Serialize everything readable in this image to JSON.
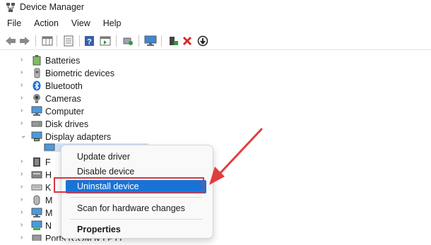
{
  "window": {
    "title": "Device Manager"
  },
  "menubar": {
    "items": [
      "File",
      "Action",
      "View",
      "Help"
    ]
  },
  "toolbar": {
    "icons": [
      "back-arrow-icon",
      "forward-arrow-icon",
      "properties-grid-icon",
      "show-hidden-icon",
      "help-icon",
      "action-pane-icon",
      "scan-hardware-icon",
      "monitor-icon",
      "update-driver-icon",
      "uninstall-x-icon",
      "disable-device-icon"
    ]
  },
  "tree": {
    "items": [
      {
        "label": "Batteries",
        "expanded": false
      },
      {
        "label": "Biometric devices",
        "expanded": false
      },
      {
        "label": "Bluetooth",
        "expanded": false
      },
      {
        "label": "Cameras",
        "expanded": false
      },
      {
        "label": "Computer",
        "expanded": false
      },
      {
        "label": "Disk drives",
        "expanded": false
      },
      {
        "label": "Display adapters",
        "expanded": true
      },
      {
        "label": "F",
        "expanded": false
      },
      {
        "label": "H",
        "expanded": false
      },
      {
        "label": "K",
        "expanded": false
      },
      {
        "label": "M",
        "expanded": false
      },
      {
        "label": "M",
        "expanded": false
      },
      {
        "label": "N",
        "expanded": false
      },
      {
        "label": "Ports (COM & LPT)",
        "expanded": false
      }
    ]
  },
  "context_menu": {
    "update_driver": "Update driver",
    "disable_device": "Disable device",
    "uninstall_device": "Uninstall device",
    "scan_hardware": "Scan for hardware changes",
    "properties": "Properties"
  },
  "colors": {
    "highlight": "#1a73d4",
    "annotation": "#d9363e"
  }
}
